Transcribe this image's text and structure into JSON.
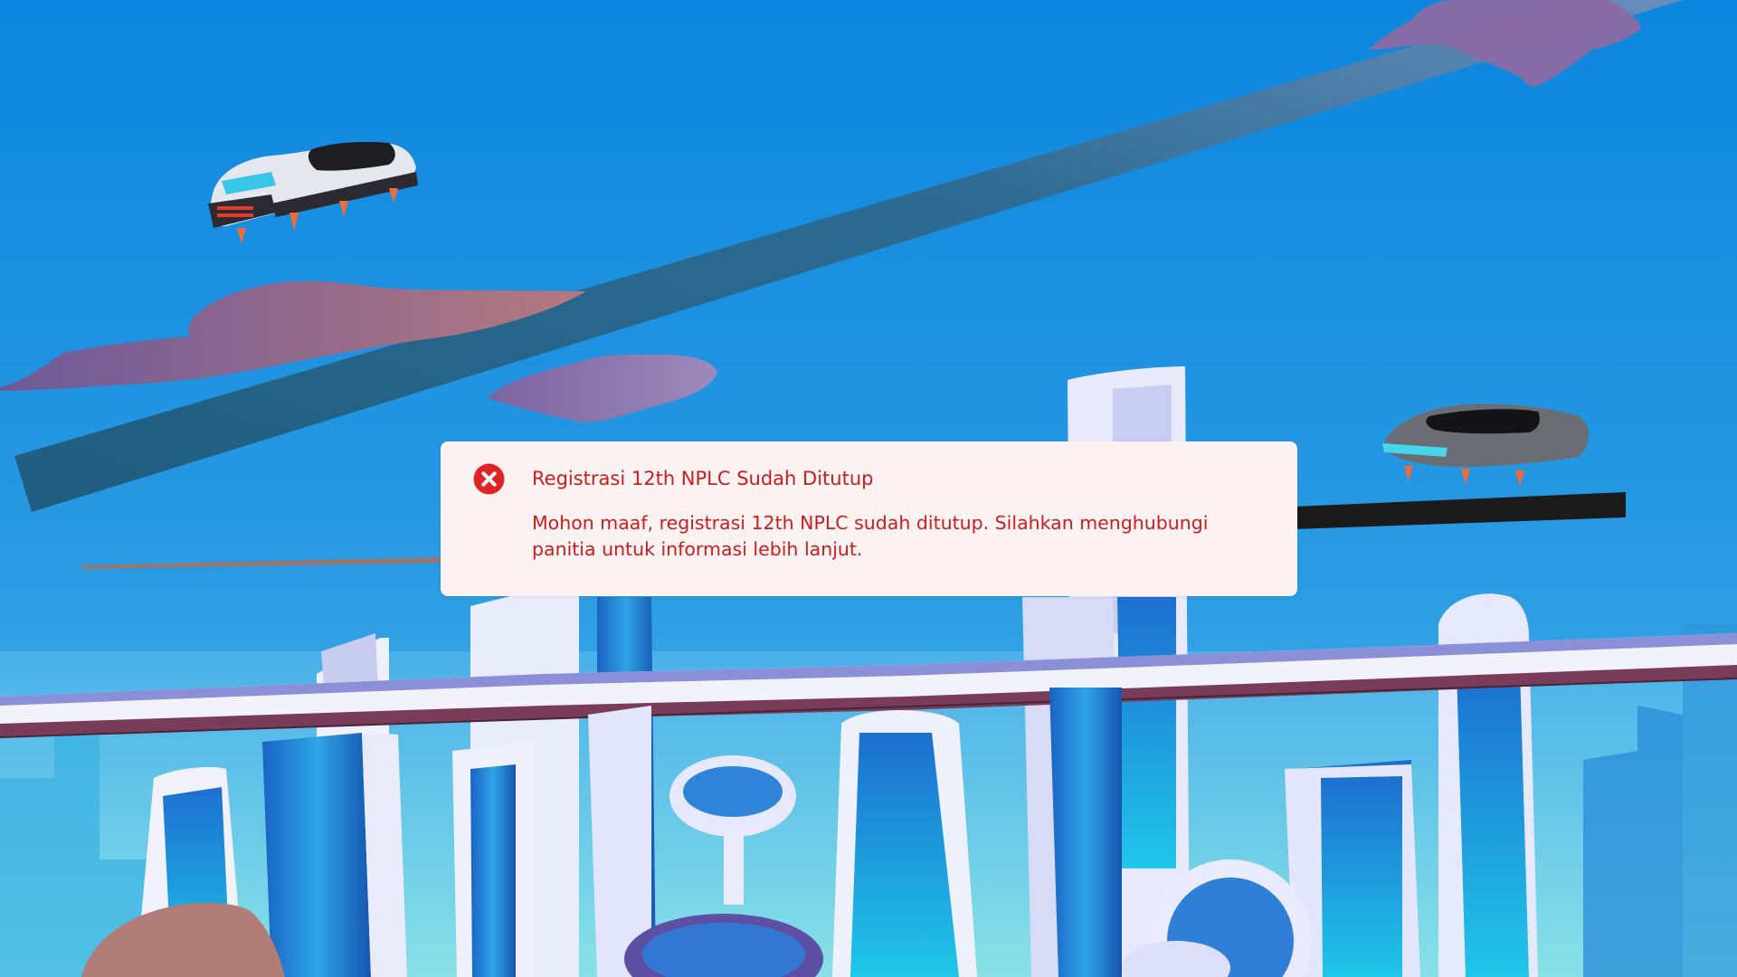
{
  "alert": {
    "title": "Registrasi 12th NPLC Sudah Ditutup",
    "message": "Mohon maaf, registrasi 12th NPLC sudah ditutup. Silahkan menghubungi panitia untuk informasi lebih lanjut.",
    "icon": "error-x-circle-icon",
    "text_color": "#c81e1e",
    "icon_color": "#e02424",
    "background_color": "#fdf2f2"
  },
  "background": {
    "sky_color": "#1f8ee0",
    "description_free": true
  }
}
